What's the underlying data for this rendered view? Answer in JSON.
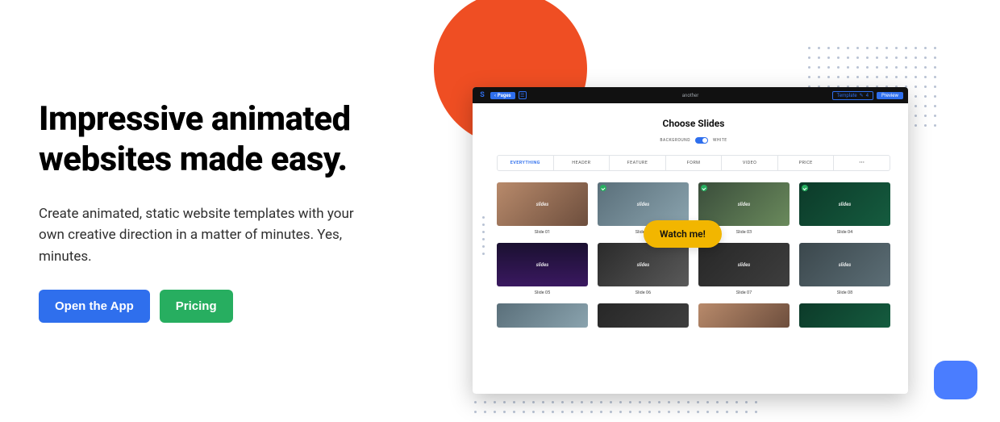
{
  "hero": {
    "headline": "Impressive animated websites made easy.",
    "subhead": "Create animated, static website templates with your own creative direction in a matter of minutes. Yes, minutes.",
    "open_app_label": "Open the App",
    "pricing_label": "Pricing"
  },
  "app": {
    "pages_btn": "Pages",
    "doc_title": "another",
    "template_label": "Template",
    "template_count": "4",
    "preview_label": "Preview",
    "choose_title": "Choose Slides",
    "bg_label_left": "BACKGROUND",
    "bg_label_right": "WHITE",
    "tabs": [
      {
        "label": "EVERYTHING",
        "active": true
      },
      {
        "label": "HEADER",
        "active": false
      },
      {
        "label": "FEATURE",
        "active": false
      },
      {
        "label": "FORM",
        "active": false
      },
      {
        "label": "VIDEO",
        "active": false
      },
      {
        "label": "PRICE",
        "active": false
      },
      {
        "label": "•••",
        "active": false
      }
    ],
    "slides_row1": [
      {
        "caption": "Slide 01",
        "checked": false,
        "bg": "bg1"
      },
      {
        "caption": "Slide 02",
        "checked": true,
        "bg": "bg2"
      },
      {
        "caption": "Slide 03",
        "checked": true,
        "bg": "bg3"
      },
      {
        "caption": "Slide 04",
        "checked": true,
        "bg": "bg4"
      }
    ],
    "slides_row2": [
      {
        "caption": "Slide 05",
        "bg": "bg5"
      },
      {
        "caption": "Slide 06",
        "bg": "bg6"
      },
      {
        "caption": "Slide 07",
        "bg": "bg7"
      },
      {
        "caption": "Slide 08",
        "bg": "bg8"
      }
    ],
    "watch_label": "Watch me!",
    "slide_brand": "slides"
  },
  "colors": {
    "orange": "#ef4e23",
    "blue": "#2f6fed",
    "green": "#27ae60",
    "yellow": "#f2b600",
    "chat_blue": "#4a7dff"
  }
}
